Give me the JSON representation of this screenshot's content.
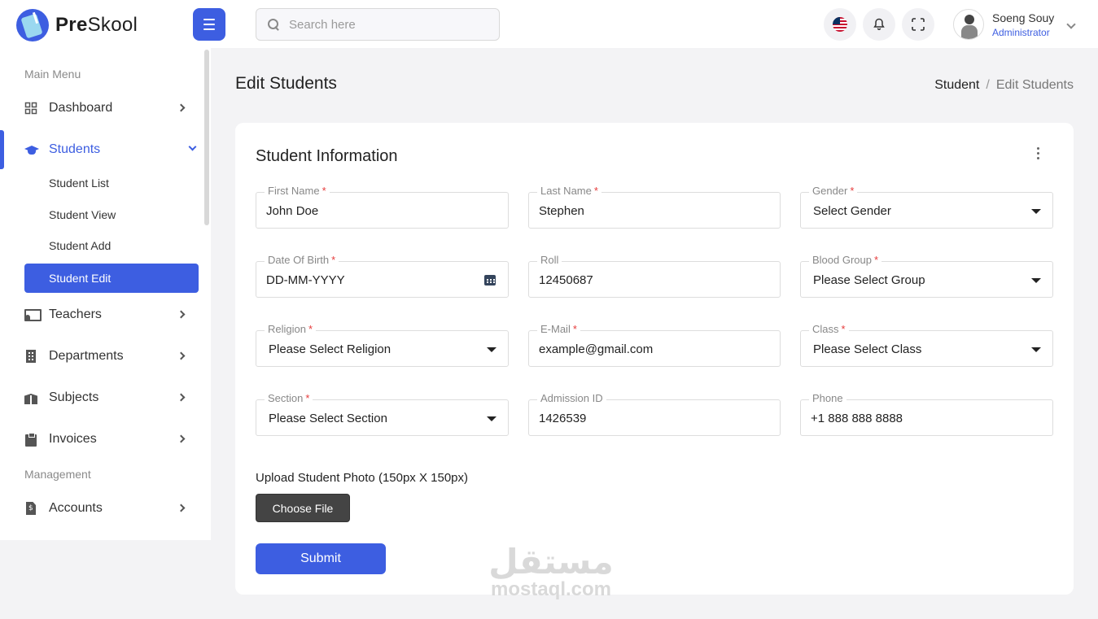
{
  "header": {
    "brand_bold": "Pre",
    "brand_rest": "Skool",
    "search_placeholder": "Search here",
    "user_name": "Soeng Souy",
    "user_role": "Administrator"
  },
  "sidebar": {
    "main_menu_title": "Main Menu",
    "management_title": "Management",
    "items": [
      {
        "label": "Dashboard",
        "icon": "dashboard-icon"
      },
      {
        "label": "Students",
        "icon": "graduation-cap-icon",
        "active": true
      },
      {
        "label": "Teachers",
        "icon": "teacher-icon"
      },
      {
        "label": "Departments",
        "icon": "building-icon"
      },
      {
        "label": "Subjects",
        "icon": "books-icon"
      },
      {
        "label": "Invoices",
        "icon": "clipboard-icon"
      },
      {
        "label": "Accounts",
        "icon": "accounts-file-icon"
      }
    ],
    "student_sub": [
      "Student List",
      "Student View",
      "Student Add",
      "Student Edit"
    ]
  },
  "page": {
    "title": "Edit Students",
    "breadcrumb_home": "Student",
    "breadcrumb_sep": "/",
    "breadcrumb_current": "Edit Students"
  },
  "form": {
    "title": "Student Information",
    "required_mark": "*",
    "fields": {
      "first_name": {
        "label": "First Name",
        "value": "John Doe"
      },
      "last_name": {
        "label": "Last Name",
        "value": "Stephen"
      },
      "gender": {
        "label": "Gender",
        "value": "Select Gender"
      },
      "dob": {
        "label": "Date Of Birth",
        "value": "DD-MM-YYYY"
      },
      "roll": {
        "label": "Roll",
        "value": "12450687"
      },
      "blood_group": {
        "label": "Blood Group",
        "value": "Please Select Group"
      },
      "religion": {
        "label": "Religion",
        "value": "Please Select Religion"
      },
      "email": {
        "label": "E-Mail",
        "value": "example@gmail.com"
      },
      "class": {
        "label": "Class",
        "value": "Please Select Class"
      },
      "section": {
        "label": "Section",
        "value": "Please Select Section"
      },
      "admission_id": {
        "label": "Admission ID",
        "value": "1426539"
      },
      "phone": {
        "label": "Phone",
        "value": "+1 888 888 8888"
      }
    },
    "upload_label": "Upload Student Photo (150px X 150px)",
    "choose_file": "Choose File",
    "submit": "Submit"
  },
  "watermark": {
    "arabic": "مستقل",
    "latin": "mostaql.com"
  },
  "colors": {
    "accent": "#3d5ee1",
    "required": "#e63c3c"
  }
}
